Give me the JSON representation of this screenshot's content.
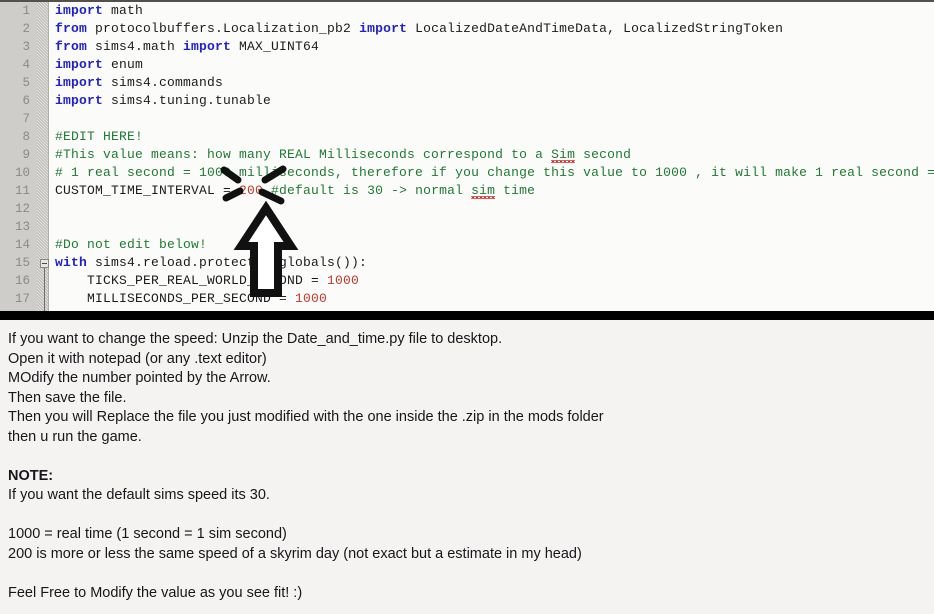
{
  "editor": {
    "name": "python-code-editor",
    "filename": "Date_and_time.py",
    "colors": {
      "keyword": "#2020cf",
      "comment": "#1f7a33",
      "number": "#c0392b",
      "plain": "#1b1b1b",
      "gutter_bg": "#cfcdc9",
      "editor_bg": "#fbfbf9",
      "divider": "#000000",
      "panel_bg": "#f4f3f1",
      "spellcheck_underline": "#d42a2a"
    },
    "line_numbers": [
      "1",
      "2",
      "3",
      "4",
      "5",
      "6",
      "7",
      "8",
      "9",
      "10",
      "11",
      "12",
      "13",
      "14",
      "15",
      "16",
      "17"
    ],
    "lines": [
      {
        "n": "1",
        "segments": [
          {
            "t": "import ",
            "c": "kw"
          },
          {
            "t": "math",
            "c": "pl"
          }
        ]
      },
      {
        "n": "2",
        "segments": [
          {
            "t": "from ",
            "c": "kw"
          },
          {
            "t": "protocolbuffers.Localization_pb2 ",
            "c": "pl"
          },
          {
            "t": "import ",
            "c": "kw"
          },
          {
            "t": "LocalizedDateAndTimeData, LocalizedStringToken",
            "c": "pl"
          }
        ]
      },
      {
        "n": "3",
        "segments": [
          {
            "t": "from ",
            "c": "kw"
          },
          {
            "t": "sims4.math ",
            "c": "pl"
          },
          {
            "t": "import ",
            "c": "kw"
          },
          {
            "t": "MAX_UINT64",
            "c": "pl"
          }
        ]
      },
      {
        "n": "4",
        "segments": [
          {
            "t": "import ",
            "c": "kw"
          },
          {
            "t": "enum",
            "c": "pl"
          }
        ]
      },
      {
        "n": "5",
        "segments": [
          {
            "t": "import ",
            "c": "kw"
          },
          {
            "t": "sims4.commands",
            "c": "pl"
          }
        ]
      },
      {
        "n": "6",
        "segments": [
          {
            "t": "import ",
            "c": "kw"
          },
          {
            "t": "sims4.tuning.tunable",
            "c": "pl"
          }
        ]
      },
      {
        "n": "7",
        "segments": []
      },
      {
        "n": "8",
        "segments": [
          {
            "t": "#EDIT HERE!",
            "c": "cm"
          }
        ]
      },
      {
        "n": "9",
        "segments": [
          {
            "t": "#This value means: how many REAL Milliseconds correspond to a ",
            "c": "cm"
          },
          {
            "t": "Sim",
            "c": "cm",
            "misspelled": true
          },
          {
            "t": " second",
            "c": "cm"
          }
        ]
      },
      {
        "n": "10",
        "segments": [
          {
            "t": "# 1 real second = 1000 milliseconds, therefore if you change this value to 1000 , it will make 1 real second =",
            "c": "cm"
          }
        ]
      },
      {
        "n": "11",
        "segments": [
          {
            "t": "CUSTOM_TIME_INTERVAL = ",
            "c": "pl"
          },
          {
            "t": "200",
            "c": "num"
          },
          {
            "t": " #default is 30 -> normal ",
            "c": "cm"
          },
          {
            "t": "sim",
            "c": "cm",
            "misspelled": true
          },
          {
            "t": " time",
            "c": "cm"
          }
        ]
      },
      {
        "n": "12",
        "segments": []
      },
      {
        "n": "13",
        "segments": []
      },
      {
        "n": "14",
        "segments": [
          {
            "t": "#Do not edit below!",
            "c": "cm"
          }
        ]
      },
      {
        "n": "15",
        "segments": [
          {
            "t": "with ",
            "c": "kw"
          },
          {
            "t": "sims4.reload.protected(globals()):",
            "c": "pl"
          }
        ]
      },
      {
        "n": "16",
        "segments": [
          {
            "t": "    TICKS_PER_REAL_WORLD_SECOND = ",
            "c": "pl"
          },
          {
            "t": "1000",
            "c": "num"
          }
        ]
      },
      {
        "n": "17",
        "segments": [
          {
            "t": "    MILLISECONDS_PER_SECOND = ",
            "c": "pl"
          },
          {
            "t": "1000",
            "c": "num"
          }
        ]
      }
    ],
    "annotation": {
      "arrow_label": "up-arrow pointing at CUSTOM_TIME_INTERVAL value",
      "sparkle_label": "highlight sparkle around the value 200",
      "target_value": "200"
    }
  },
  "instructions": {
    "lines": [
      {
        "text": "If you want to change the speed: Unzip the Date_and_time.py file to desktop.",
        "bold": false
      },
      {
        "text": "Open it with notepad (or any .text editor)",
        "bold": false
      },
      {
        "text": "MOdify the number pointed by the Arrow.",
        "bold": false
      },
      {
        "text": "Then save the file.",
        "bold": false
      },
      {
        "text": "Then you will Replace the file you just modified with the one inside the .zip in the mods folder",
        "bold": false
      },
      {
        "text": "then u run the game.",
        "bold": false
      },
      {
        "text": " ",
        "bold": false
      },
      {
        "text": "NOTE:",
        "bold": true
      },
      {
        "text": "If you want the default sims speed its 30.",
        "bold": false
      },
      {
        "text": " ",
        "bold": false
      },
      {
        "text": "1000 = real time (1 second = 1 sim second)",
        "bold": false
      },
      {
        "text": "200 is more or less the same speed of a skyrim day (not exact but a estimate in my head)",
        "bold": false
      },
      {
        "text": " ",
        "bold": false
      },
      {
        "text": "Feel Free to Modify the value as you see fit! :)",
        "bold": false
      }
    ]
  }
}
